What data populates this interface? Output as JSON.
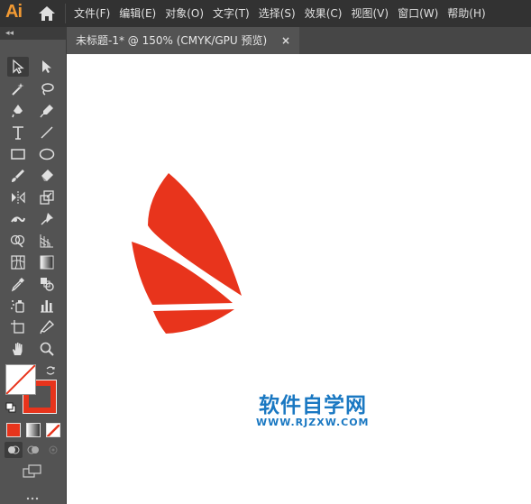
{
  "app": {
    "logo_text": "Ai"
  },
  "menubar": {
    "items": [
      "文件(F)",
      "编辑(E)",
      "对象(O)",
      "文字(T)",
      "选择(S)",
      "效果(C)",
      "视图(V)",
      "窗口(W)",
      "帮助(H)"
    ]
  },
  "toolbox": {
    "collapse_glyph": "◂◂",
    "tools": [
      "selection-tool",
      "direct-selection-tool",
      "magic-wand-tool",
      "lasso-tool",
      "pen-tool",
      "curvature-tool",
      "type-tool",
      "line-segment-tool",
      "rectangle-tool",
      "ellipse-tool",
      "paintbrush-tool",
      "eraser-tool",
      "reflect-tool",
      "scale-tool",
      "width-tool",
      "puppet-warp-tool",
      "shape-builder-tool",
      "perspective-grid-tool",
      "mesh-tool",
      "gradient-tool",
      "eyedropper-tool",
      "blend-tool",
      "symbol-sprayer-tool",
      "column-graph-tool",
      "artboard-tool",
      "slice-tool",
      "hand-tool",
      "zoom-tool"
    ],
    "fill_color": "#ffffff",
    "stroke_color": "#e8341c"
  },
  "document_tab": {
    "title": "未标题-1* @ 150% (CMYK/GPU 预览)",
    "close_glyph": "×"
  },
  "artwork": {
    "color": "#e8341c"
  },
  "watermark": {
    "title": "软件自学网",
    "url": "WWW.RJZXW.COM",
    "color": "#1a78c2"
  }
}
